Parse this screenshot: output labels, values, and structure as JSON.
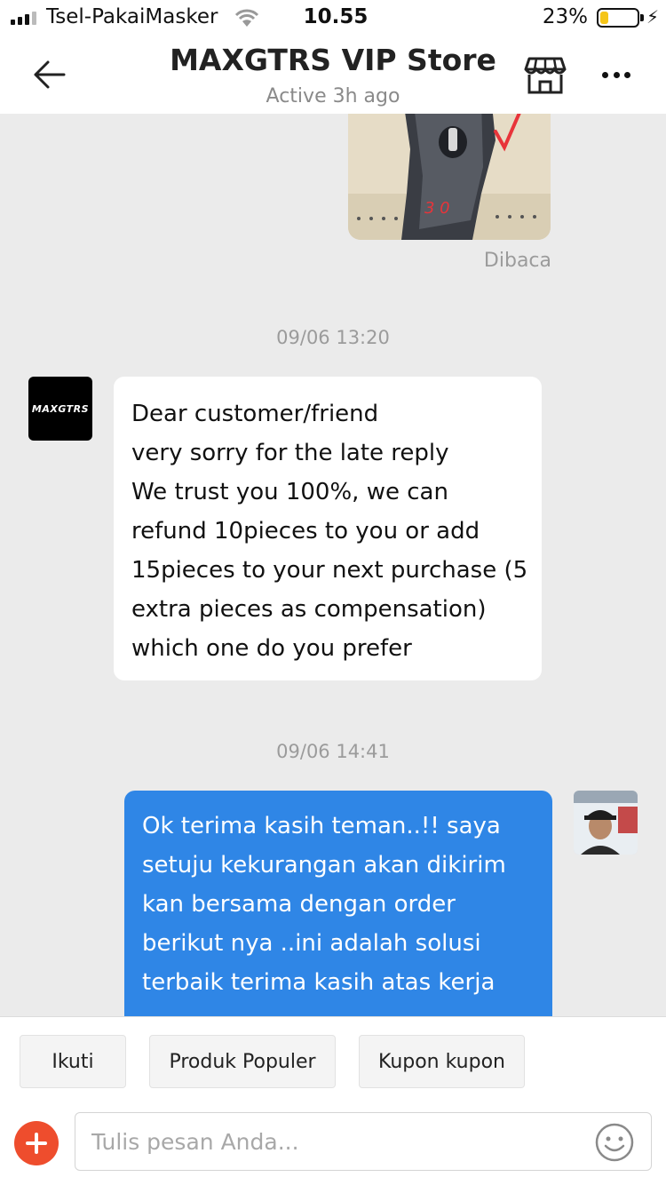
{
  "status_bar": {
    "carrier": "Tsel-PakaiMasker",
    "time": "10.55",
    "battery_percent": "23%",
    "battery_level": 0.23
  },
  "header": {
    "title": "MAXGTRS VIP Store",
    "subtitle": "Active 3h ago",
    "icons": [
      "back-arrow-icon",
      "store-icon",
      "more-icon"
    ]
  },
  "chat": {
    "read_status": "Dibaca",
    "timestamps": [
      "09/06 13:20",
      "09/06 14:41"
    ],
    "store_avatar_text": "MAXGTRS",
    "messages": [
      {
        "sender": "store",
        "lines": [
          "Dear customer/friend",
          "very sorry for the late reply",
          "We trust you 100%, we can",
          "refund 10pieces to you or add",
          "15pieces to your next purchase (5",
          "extra pieces as compensation)",
          "which one do you prefer"
        ]
      },
      {
        "sender": "user",
        "lines": [
          "Ok terima kasih teman..!! saya",
          "setuju kekurangan akan dikirim",
          "kan bersama dengan order",
          "berikut nya ..ini adalah solusi",
          "terbaik terima kasih atas kerja"
        ]
      }
    ]
  },
  "quick_replies": [
    "Ikuti",
    "Produk Populer",
    "Kupon kupon"
  ],
  "composer": {
    "placeholder": "Tulis pesan Anda...",
    "value": "",
    "accent_color": "#ee4d2d"
  },
  "colors": {
    "outgoing_bubble": "#2f86e6",
    "background": "#ebebeb"
  }
}
